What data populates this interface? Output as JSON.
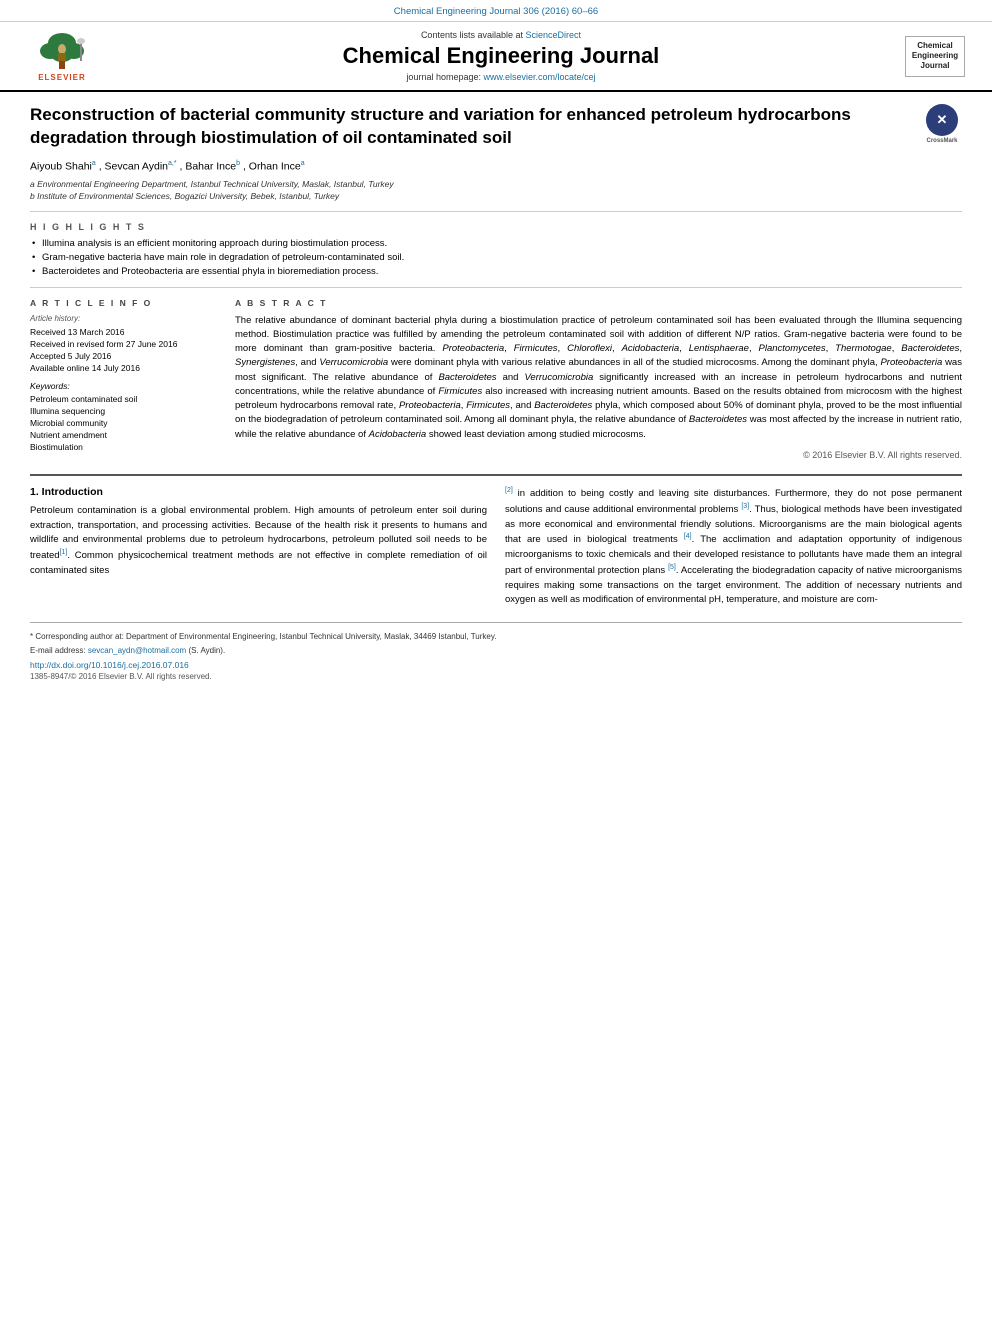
{
  "journal_bar": {
    "text": "Chemical Engineering Journal 306 (2016) 60–66"
  },
  "header": {
    "science_direct": "Contents lists available at",
    "science_direct_link": "ScienceDirect",
    "journal_title": "Chemical Engineering Journal",
    "homepage_prefix": "journal homepage:",
    "homepage_url": "www.elsevier.com/locate/cej",
    "badge_lines": [
      "Chemical",
      "Engineering",
      "Journal"
    ]
  },
  "crossmark": {
    "label": "CrossMark"
  },
  "article": {
    "title": "Reconstruction of bacterial community structure and variation for enhanced petroleum hydrocarbons degradation through biostimulation of oil contaminated soil",
    "authors": "Aiyoub Shahi",
    "author_a_super": "a",
    "author2": ", Sevcan Aydin",
    "author2_super": "a,*",
    "author3": ", Bahar Ince",
    "author3_super": "b",
    "author4": ", Orhan Ince",
    "author4_super": "a",
    "affiliation_a": "a Environmental Engineering Department, Istanbul Technical University, Maslak, Istanbul, Turkey",
    "affiliation_b": "b Institute of Environmental Sciences, Bogazici University, Bebek, Istanbul, Turkey"
  },
  "highlights": {
    "title": "H I G H L I G H T S",
    "items": [
      "Illumina analysis is an efficient monitoring approach during biostimulation process.",
      "Gram-negative bacteria have main role in degradation of petroleum-contaminated soil.",
      "Bacteroidetes and Proteobacteria are essential phyla in bioremediation process."
    ]
  },
  "article_info": {
    "section_title": "A R T I C L E   I N F O",
    "history_label": "Article history:",
    "dates": [
      "Received 13 March 2016",
      "Received in revised form 27 June 2016",
      "Accepted 5 July 2016",
      "Available online 14 July 2016"
    ],
    "keywords_title": "Keywords:",
    "keywords": [
      "Petroleum contaminated soil",
      "Illumina sequencing",
      "Microbial community",
      "Nutrient amendment",
      "Biostimulation"
    ]
  },
  "abstract": {
    "section_title": "A B S T R A C T",
    "text": "The relative abundance of dominant bacterial phyla during a biostimulation practice of petroleum contaminated soil has been evaluated through the Illumina sequencing method. Biostimulation practice was fulfilled by amending the petroleum contaminated soil with addition of different N/P ratios. Gram-negative bacteria were found to be more dominant than gram-positive bacteria. Proteobacteria, Firmicutes, Chloroflexi, Acidobacteria, Lentisphaerae, Planctomycetes, Thermotogae, Bacteroidetes, Synergistenes, and Verrucomicrobia were dominant phyla with various relative abundances in all of the studied microcosms. Among the dominant phyla, Proteobacteria was most significant. The relative abundance of Bacteroidetes and Verrucomicrobia significantly increased with an increase in petroleum hydrocarbons and nutrient concentrations, while the relative abundance of Firmicutes also increased with increasing nutrient amounts. Based on the results obtained from microcosm with the highest petroleum hydrocarbons removal rate, Proteobacteria, Firmicutes, and Bacteroidetes phyla, which composed about 50% of dominant phyla, proved to be the most influential on the biodegradation of petroleum contaminated soil. Among all dominant phyla, the relative abundance of Bacteroidetes was most affected by the increase in nutrient ratio, while the relative abundance of Acidobacteria showed least deviation among studied microcosms.",
    "copyright": "© 2016 Elsevier B.V. All rights reserved."
  },
  "intro": {
    "section_title": "1. Introduction",
    "left_para1": "Petroleum contamination is a global environmental problem. High amounts of petroleum enter soil during extraction, transportation, and processing activities. Because of the health risk it presents to humans and wildlife and environmental problems due to petroleum hydrocarbons, petroleum polluted soil needs to be treated",
    "ref1": "[1]",
    "left_para1_cont": ". Common physicochemical treatment methods are not effective in complete remediation of oil contaminated sites",
    "right_para_start": "[2]",
    "right_para1": " in addition to being costly and leaving site disturbances. Furthermore, they do not pose permanent solutions and cause additional environmental problems ",
    "ref3": "[3]",
    "right_para1_cont": ". Thus, biological methods have been investigated as more economical and environmental friendly solutions. Microorganisms are the main biological agents that are used in biological treatments ",
    "ref4": "[4]",
    "right_para2": ". The acclimation and adaptation opportunity of indigenous microorganisms to toxic chemicals and their developed resistance to pollutants have made them an integral part of environmental protection plans ",
    "ref5": "[5]",
    "right_para3": ". Accelerating the biodegradation capacity of native microorganisms requires making some transactions on the target environment. The addition of necessary nutrients and oxygen as well as modification of environmental pH, temperature, and moisture are com-"
  },
  "footer": {
    "footnote_star": "* Corresponding author at: Department of Environmental Engineering, Istanbul Technical University, Maslak, 34469 Istanbul, Turkey.",
    "email_label": "E-mail address:",
    "email": "sevcan_aydn@hotmail.com",
    "email_name": "(S. Aydin).",
    "doi": "http://dx.doi.org/10.1016/j.cej.2016.07.016",
    "issn": "1385-8947/© 2016 Elsevier B.V. All rights reserved."
  }
}
